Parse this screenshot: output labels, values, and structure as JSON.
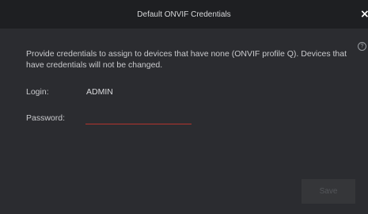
{
  "dialog": {
    "title": "Default ONVIF Credentials",
    "close_glyph": "×",
    "help_glyph": "?",
    "description": "Provide credentials to assign to devices that have none (ONVIF profile Q). Devices that have credentials will not be changed.",
    "login_label": "Login:",
    "login_value": "ADMIN",
    "password_label": "Password:",
    "password_value": "",
    "save_label": "Save"
  },
  "colors": {
    "background": "#2b2c30",
    "titlebar": "#1e1f22",
    "input_underline_error": "#b3342d",
    "save_disabled_bg": "#353639",
    "save_disabled_text": "#54565a"
  },
  "icons": {
    "close": "close-icon",
    "help": "help-icon"
  }
}
